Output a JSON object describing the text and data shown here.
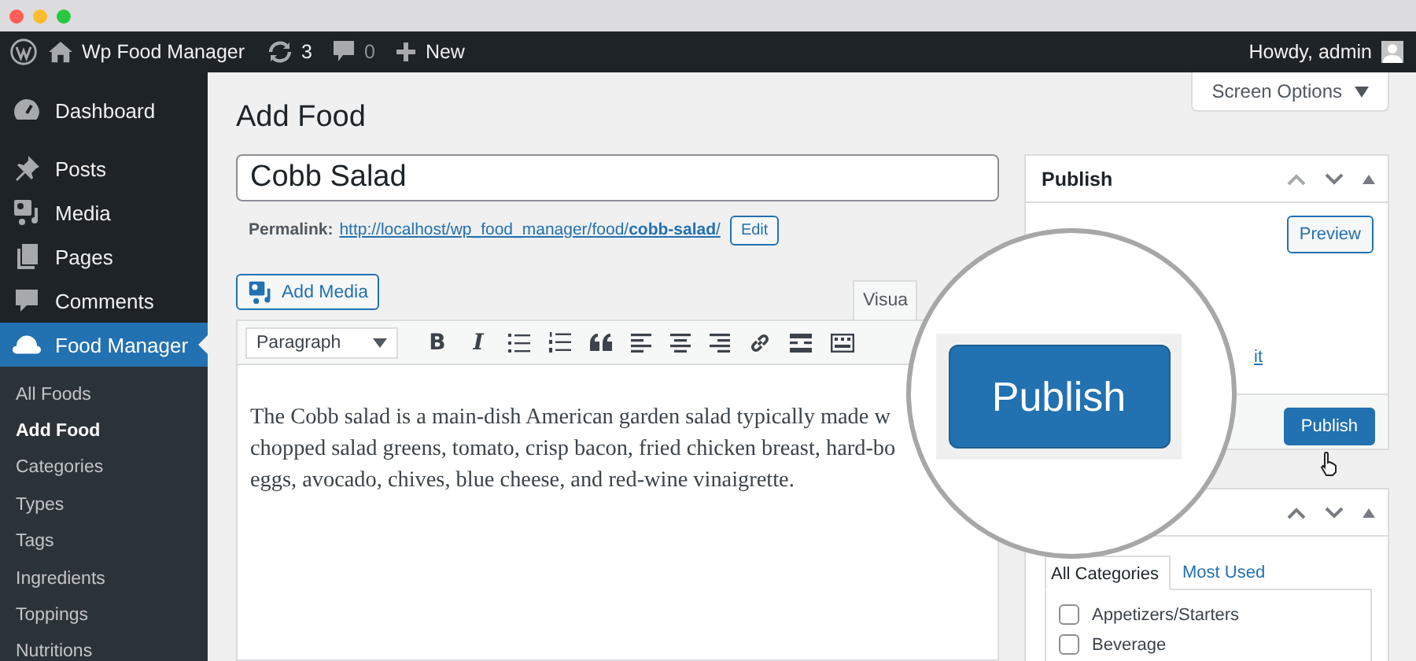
{
  "window": {
    "controls": [
      {
        "color": "#ff5f57"
      },
      {
        "color": "#febc2e"
      },
      {
        "color": "#28c840"
      }
    ]
  },
  "admin_bar": {
    "site": "Wp Food Manager",
    "updates": "3",
    "comments": "0",
    "new": "New",
    "greeting": "Howdy, admin"
  },
  "sidebar": {
    "items": [
      {
        "label": "Dashboard",
        "selected": false
      },
      {
        "label": "Posts",
        "selected": false
      },
      {
        "label": "Media",
        "selected": false
      },
      {
        "label": "Pages",
        "selected": false
      },
      {
        "label": "Comments",
        "selected": false
      },
      {
        "label": "Food Manager",
        "selected": true,
        "children": [
          {
            "label": "All Foods",
            "selected": false
          },
          {
            "label": "Add Food",
            "selected": true
          },
          {
            "label": "Categories",
            "selected": false
          },
          {
            "label": "Types",
            "selected": false
          },
          {
            "label": "Tags",
            "selected": false
          },
          {
            "label": "Ingredients",
            "selected": false
          },
          {
            "label": "Toppings",
            "selected": false
          },
          {
            "label": "Nutritions",
            "selected": false
          }
        ]
      }
    ]
  },
  "screen_options": "Screen Options",
  "page_title": "Add Food",
  "title_field": {
    "value": "Cobb Salad"
  },
  "permalink": {
    "label": "Permalink:",
    "url": "http://localhost/wp_food_manager/food/**cobb-salad**/",
    "edit": "Edit"
  },
  "add_media": "Add Media",
  "editor": {
    "tab": "Visua",
    "format": "Paragraph",
    "bold": "B",
    "italic": "I",
    "lines": [
      "The Cobb salad is a main-dish American garden salad typically made w",
      "chopped salad greens, tomato, crisp bacon, fried chicken breast, hard-bo",
      "eggs, avocado, chives, blue cheese, and red-wine vinaigrette."
    ]
  },
  "publish_box": {
    "title": "Publish",
    "preview": "Preview",
    "edit_link": "it",
    "publish": "Publish"
  },
  "magnifier": {
    "button": "Publish"
  },
  "categories_box": {
    "tabs": [
      {
        "label": "All Categories",
        "selected": true
      },
      {
        "label": "Most Used",
        "selected": false
      }
    ],
    "items": [
      {
        "label": "Appetizers/Starters",
        "checked": false
      },
      {
        "label": "Beverage",
        "checked": false
      }
    ]
  }
}
